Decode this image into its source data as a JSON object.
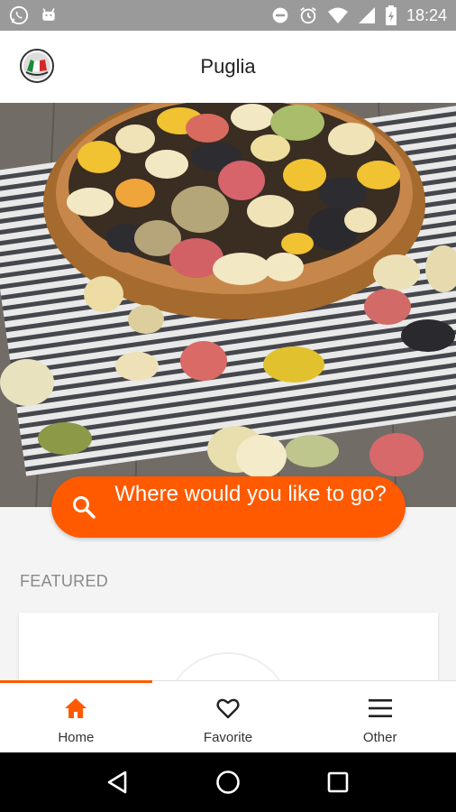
{
  "status_bar": {
    "time": "18:24",
    "icons": [
      "whatsapp-icon",
      "android-icon",
      "do-not-disturb-icon",
      "alarm-icon",
      "wifi-icon",
      "signal-icon",
      "battery-icon"
    ]
  },
  "app_bar": {
    "title": "Puglia",
    "logo_icon": "italy-flag-logo"
  },
  "hero": {
    "image": "orecchiette-pasta-bowl-photo"
  },
  "search": {
    "label": "Where would you like to go?",
    "icon": "search-icon"
  },
  "featured": {
    "section_label": "FEATURED"
  },
  "bottom_nav": {
    "items": [
      {
        "label": "Home",
        "icon": "home-icon",
        "active": true
      },
      {
        "label": "Favorite",
        "icon": "heart-icon",
        "active": false
      },
      {
        "label": "Other",
        "icon": "menu-icon",
        "active": false
      }
    ]
  },
  "system_nav": {
    "buttons": [
      "back-icon",
      "home-circle-icon",
      "recents-icon"
    ]
  },
  "colors": {
    "accent": "#ff5a00",
    "status_bar": "#9a9a9a",
    "background": "#f4f4f4"
  }
}
